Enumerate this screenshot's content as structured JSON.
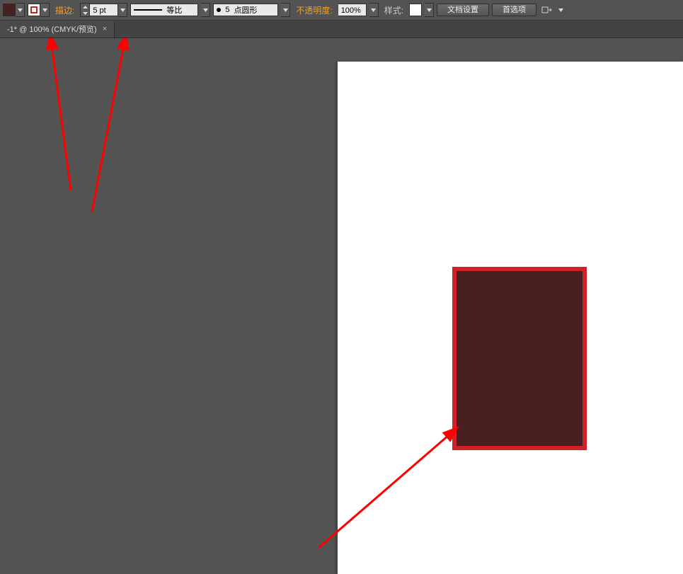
{
  "toolbar": {
    "fill_color": "#4a1f1f",
    "stroke_color": "#d02020",
    "stroke_label": "描边:",
    "stroke_weight": "5 pt",
    "profile_equal": "等比",
    "dash_pattern_prefix": "5",
    "dash_pattern_label": "点圆形",
    "opacity_label": "不透明度:",
    "opacity_value": "100%",
    "style_label": "样式:",
    "doc_setup": "文档设置",
    "preferences": "首选项"
  },
  "tab": {
    "title": "-1* @ 100% (CMYK/预览)",
    "close": "×"
  },
  "shape": {
    "fill": "#4a1f1f",
    "stroke": "#d02028",
    "stroke_weight_px": 6
  },
  "annotations": {
    "arrow_color": "#ff0000"
  }
}
